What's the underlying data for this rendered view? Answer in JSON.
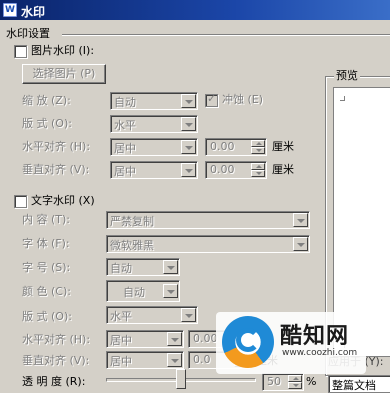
{
  "window": {
    "title": "水印",
    "icon": "wps-writer-icon"
  },
  "section": {
    "label": "水印设置"
  },
  "picture": {
    "checkbox_label": "图片水印 (I):",
    "choose_button": "选择图片 (P)",
    "scale_label": "缩    放 (Z):",
    "scale_value": "自动",
    "washout_label": "冲蚀 (E)",
    "layout_label": "版    式 (O):",
    "layout_value": "水平",
    "halign_label": "水平对齐 (H):",
    "halign_value": "居中",
    "halign_offset": "0.00",
    "valign_label": "垂直对齐 (V):",
    "valign_value": "居中",
    "valign_offset": "0.00",
    "unit": "厘米"
  },
  "text": {
    "checkbox_label": "文字水印 (X)",
    "content_label": "内    容 (T):",
    "content_value": "严禁复制",
    "font_label": "字    体 (F):",
    "font_value": "微软雅黑",
    "size_label": "字    号 (S):",
    "size_value": "自动",
    "color_label": "颜    色 (C):",
    "color_value": "自动",
    "layout_label": "版    式 (O):",
    "layout_value": "水平",
    "halign_label": "水平对齐 (H):",
    "halign_value": "居中",
    "halign_offset": "0.00",
    "valign_label": "垂直对齐 (V):",
    "valign_value": "居中",
    "valign_offset": "0.0",
    "unit": "厘米",
    "transparency_label": "透 明 度 (R):",
    "transparency_value": "50",
    "transparency_unit": "%",
    "transparency_fraction": 0.5
  },
  "preview": {
    "label": "预览",
    "apply_label": "应用于 (Y):",
    "apply_value": "整篇文档"
  },
  "overlay": {
    "brand": "酷知网",
    "url": "www.coozhi.com"
  },
  "colors": {
    "dialog_bg": "#d4d0c8",
    "titlebar": "#0a246a",
    "disabled_text": "#808080"
  }
}
